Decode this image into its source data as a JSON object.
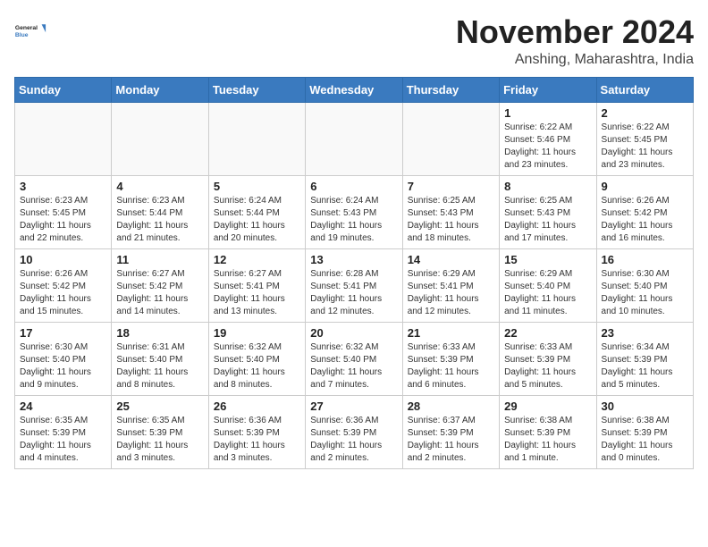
{
  "header": {
    "logo_line1": "General",
    "logo_line2": "Blue",
    "month_title": "November 2024",
    "subtitle": "Anshing, Maharashtra, India"
  },
  "weekdays": [
    "Sunday",
    "Monday",
    "Tuesday",
    "Wednesday",
    "Thursday",
    "Friday",
    "Saturday"
  ],
  "weeks": [
    [
      {
        "day": "",
        "info": ""
      },
      {
        "day": "",
        "info": ""
      },
      {
        "day": "",
        "info": ""
      },
      {
        "day": "",
        "info": ""
      },
      {
        "day": "",
        "info": ""
      },
      {
        "day": "1",
        "info": "Sunrise: 6:22 AM\nSunset: 5:46 PM\nDaylight: 11 hours\nand 23 minutes."
      },
      {
        "day": "2",
        "info": "Sunrise: 6:22 AM\nSunset: 5:45 PM\nDaylight: 11 hours\nand 23 minutes."
      }
    ],
    [
      {
        "day": "3",
        "info": "Sunrise: 6:23 AM\nSunset: 5:45 PM\nDaylight: 11 hours\nand 22 minutes."
      },
      {
        "day": "4",
        "info": "Sunrise: 6:23 AM\nSunset: 5:44 PM\nDaylight: 11 hours\nand 21 minutes."
      },
      {
        "day": "5",
        "info": "Sunrise: 6:24 AM\nSunset: 5:44 PM\nDaylight: 11 hours\nand 20 minutes."
      },
      {
        "day": "6",
        "info": "Sunrise: 6:24 AM\nSunset: 5:43 PM\nDaylight: 11 hours\nand 19 minutes."
      },
      {
        "day": "7",
        "info": "Sunrise: 6:25 AM\nSunset: 5:43 PM\nDaylight: 11 hours\nand 18 minutes."
      },
      {
        "day": "8",
        "info": "Sunrise: 6:25 AM\nSunset: 5:43 PM\nDaylight: 11 hours\nand 17 minutes."
      },
      {
        "day": "9",
        "info": "Sunrise: 6:26 AM\nSunset: 5:42 PM\nDaylight: 11 hours\nand 16 minutes."
      }
    ],
    [
      {
        "day": "10",
        "info": "Sunrise: 6:26 AM\nSunset: 5:42 PM\nDaylight: 11 hours\nand 15 minutes."
      },
      {
        "day": "11",
        "info": "Sunrise: 6:27 AM\nSunset: 5:42 PM\nDaylight: 11 hours\nand 14 minutes."
      },
      {
        "day": "12",
        "info": "Sunrise: 6:27 AM\nSunset: 5:41 PM\nDaylight: 11 hours\nand 13 minutes."
      },
      {
        "day": "13",
        "info": "Sunrise: 6:28 AM\nSunset: 5:41 PM\nDaylight: 11 hours\nand 12 minutes."
      },
      {
        "day": "14",
        "info": "Sunrise: 6:29 AM\nSunset: 5:41 PM\nDaylight: 11 hours\nand 12 minutes."
      },
      {
        "day": "15",
        "info": "Sunrise: 6:29 AM\nSunset: 5:40 PM\nDaylight: 11 hours\nand 11 minutes."
      },
      {
        "day": "16",
        "info": "Sunrise: 6:30 AM\nSunset: 5:40 PM\nDaylight: 11 hours\nand 10 minutes."
      }
    ],
    [
      {
        "day": "17",
        "info": "Sunrise: 6:30 AM\nSunset: 5:40 PM\nDaylight: 11 hours\nand 9 minutes."
      },
      {
        "day": "18",
        "info": "Sunrise: 6:31 AM\nSunset: 5:40 PM\nDaylight: 11 hours\nand 8 minutes."
      },
      {
        "day": "19",
        "info": "Sunrise: 6:32 AM\nSunset: 5:40 PM\nDaylight: 11 hours\nand 8 minutes."
      },
      {
        "day": "20",
        "info": "Sunrise: 6:32 AM\nSunset: 5:40 PM\nDaylight: 11 hours\nand 7 minutes."
      },
      {
        "day": "21",
        "info": "Sunrise: 6:33 AM\nSunset: 5:39 PM\nDaylight: 11 hours\nand 6 minutes."
      },
      {
        "day": "22",
        "info": "Sunrise: 6:33 AM\nSunset: 5:39 PM\nDaylight: 11 hours\nand 5 minutes."
      },
      {
        "day": "23",
        "info": "Sunrise: 6:34 AM\nSunset: 5:39 PM\nDaylight: 11 hours\nand 5 minutes."
      }
    ],
    [
      {
        "day": "24",
        "info": "Sunrise: 6:35 AM\nSunset: 5:39 PM\nDaylight: 11 hours\nand 4 minutes."
      },
      {
        "day": "25",
        "info": "Sunrise: 6:35 AM\nSunset: 5:39 PM\nDaylight: 11 hours\nand 3 minutes."
      },
      {
        "day": "26",
        "info": "Sunrise: 6:36 AM\nSunset: 5:39 PM\nDaylight: 11 hours\nand 3 minutes."
      },
      {
        "day": "27",
        "info": "Sunrise: 6:36 AM\nSunset: 5:39 PM\nDaylight: 11 hours\nand 2 minutes."
      },
      {
        "day": "28",
        "info": "Sunrise: 6:37 AM\nSunset: 5:39 PM\nDaylight: 11 hours\nand 2 minutes."
      },
      {
        "day": "29",
        "info": "Sunrise: 6:38 AM\nSunset: 5:39 PM\nDaylight: 11 hours\nand 1 minute."
      },
      {
        "day": "30",
        "info": "Sunrise: 6:38 AM\nSunset: 5:39 PM\nDaylight: 11 hours\nand 0 minutes."
      }
    ]
  ]
}
